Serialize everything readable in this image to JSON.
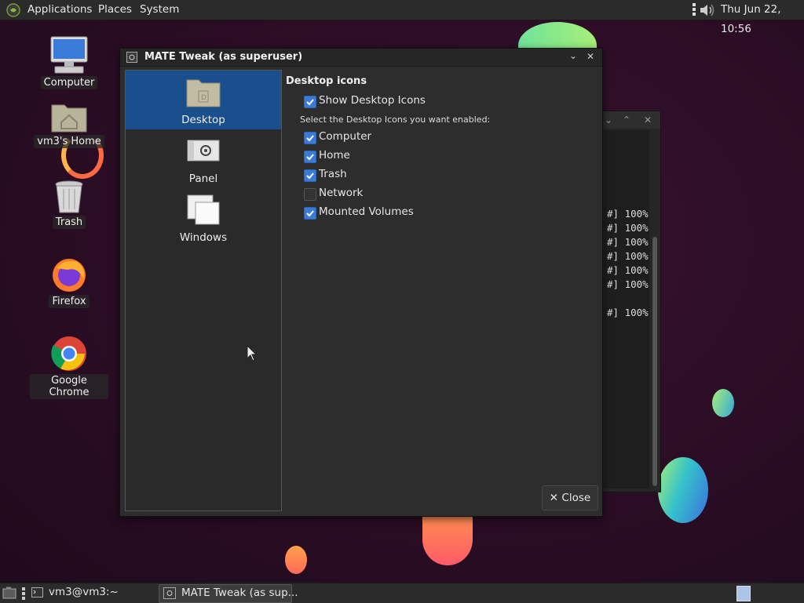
{
  "top_panel": {
    "menus": [
      "Applications",
      "Places",
      "System"
    ],
    "clock": "Thu Jun 22, 10:56"
  },
  "desktop_icons": [
    {
      "label": "Computer",
      "icon": "computer-icon"
    },
    {
      "label": "vm3's Home",
      "icon": "home-folder-icon"
    },
    {
      "label": "Trash",
      "icon": "trash-icon"
    },
    {
      "label": "Firefox",
      "icon": "firefox-icon"
    },
    {
      "label": "Google Chrome",
      "icon": "chrome-icon"
    }
  ],
  "terminal": {
    "lines": [
      "#] 100%",
      "#] 100%",
      "#] 100%",
      "#] 100%",
      "#] 100%",
      "#] 100%",
      "#] 100%"
    ]
  },
  "dialog": {
    "title": "MATE Tweak (as superuser)",
    "sidebar": [
      {
        "label": "Desktop",
        "selected": true
      },
      {
        "label": "Panel",
        "selected": false
      },
      {
        "label": "Windows",
        "selected": false
      }
    ],
    "section_title": "Desktop icons",
    "show_desktop_icons": {
      "label": "Show Desktop Icons",
      "checked": true
    },
    "hint": "Select the Desktop Icons you want enabled:",
    "options": [
      {
        "label": "Computer",
        "checked": true
      },
      {
        "label": "Home",
        "checked": true
      },
      {
        "label": "Trash",
        "checked": true
      },
      {
        "label": "Network",
        "checked": false
      },
      {
        "label": "Mounted Volumes",
        "checked": true
      }
    ],
    "close_label": "✕ Close"
  },
  "taskbar": {
    "items": [
      "vm3@vm3:~",
      "MATE Tweak (as sup..."
    ]
  },
  "colors": {
    "selection": "#1a4f8e",
    "checkbox": "#3a7bd5"
  }
}
